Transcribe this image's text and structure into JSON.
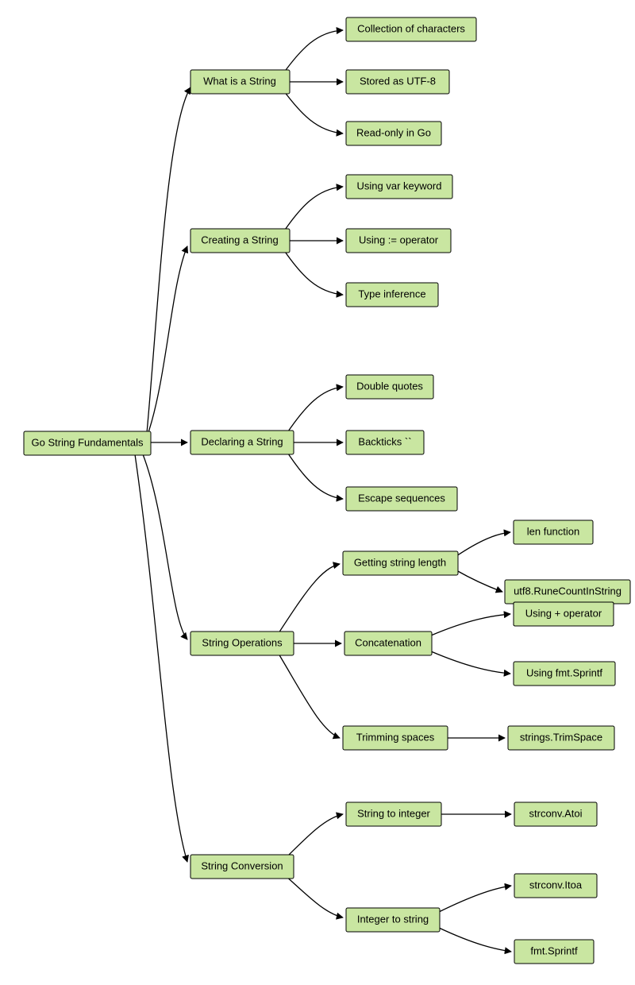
{
  "chart_data": {
    "type": "tree",
    "root": "Go String Fundamentals",
    "children": [
      {
        "label": "What is a String",
        "children": [
          {
            "label": "Collection of characters"
          },
          {
            "label": "Stored as UTF-8"
          },
          {
            "label": "Read-only in Go"
          }
        ]
      },
      {
        "label": "Creating a String",
        "children": [
          {
            "label": "Using var keyword"
          },
          {
            "label": "Using := operator"
          },
          {
            "label": "Type inference"
          }
        ]
      },
      {
        "label": "Declaring a String",
        "children": [
          {
            "label": "Double quotes"
          },
          {
            "label": "Backticks ``"
          },
          {
            "label": "Escape sequences"
          }
        ]
      },
      {
        "label": "String Operations",
        "children": [
          {
            "label": "Getting string length",
            "children": [
              {
                "label": "len function"
              },
              {
                "label": "utf8.RuneCountInString"
              }
            ]
          },
          {
            "label": "Concatenation",
            "children": [
              {
                "label": "Using + operator"
              },
              {
                "label": "Using fmt.Sprintf"
              }
            ]
          },
          {
            "label": "Trimming spaces",
            "children": [
              {
                "label": "strings.TrimSpace"
              }
            ]
          }
        ]
      },
      {
        "label": "String Conversion",
        "children": [
          {
            "label": "String to integer",
            "children": [
              {
                "label": "strconv.Atoi"
              }
            ]
          },
          {
            "label": "Integer to string",
            "children": [
              {
                "label": "strconv.Itoa"
              },
              {
                "label": "fmt.Sprintf"
              }
            ]
          }
        ]
      }
    ]
  },
  "colors": {
    "node_fill": "#c9e6a1",
    "node_stroke": "#000000",
    "edge": "#000000"
  },
  "nodes": {
    "root": "Go String Fundamentals",
    "b1": "What is a String",
    "b1c1": "Collection of characters",
    "b1c2": "Stored as UTF-8",
    "b1c3": "Read-only in Go",
    "b2": "Creating a String",
    "b2c1": "Using var keyword",
    "b2c2": "Using := operator",
    "b2c3": "Type inference",
    "b3": "Declaring a String",
    "b3c1": "Double quotes",
    "b3c2": "Backticks ``",
    "b3c3": "Escape sequences",
    "b4": "String Operations",
    "b4c1": "Getting string length",
    "b4c1g1": "len function",
    "b4c1g2": "utf8.RuneCountInString",
    "b4c2": "Concatenation",
    "b4c2g1": "Using + operator",
    "b4c2g2": "Using fmt.Sprintf",
    "b4c3": "Trimming spaces",
    "b4c3g1": "strings.TrimSpace",
    "b5": "String Conversion",
    "b5c1": "String to integer",
    "b5c1g1": "strconv.Atoi",
    "b5c2": "Integer to string",
    "b5c2g1": "strconv.Itoa",
    "b5c2g2": "fmt.Sprintf"
  }
}
